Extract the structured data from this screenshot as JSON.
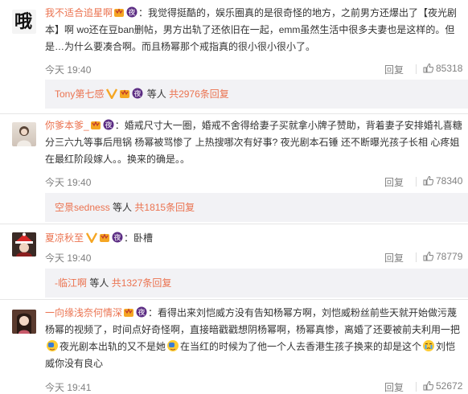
{
  "comments": [
    {
      "username": "我不适合追星啊",
      "text": "：我觉得挺酷的，娱乐圈真的是很奇怪的地方，之前男方还爆出了【夜光剧本】啊 wo还在豆ban删帖，男方出轨了还依旧在一起，emm虽然生活中很多夫妻也是这样的。但是…为什么要凑合啊。而且杨幂那个戒指真的很小很小很小了。",
      "avatar_text": "哦",
      "time": "今天 19:40",
      "reply_label": "回复",
      "likes": "85318",
      "replies": {
        "names": "Tony第七感",
        "others": "等人",
        "count": "共2976条回复"
      }
    },
    {
      "username": "你爹本爹_",
      "text": "：婚戒尺寸大一圈，婚戒不舍得给妻子买就拿小牌子赞助，背着妻子安排婚礼喜糖分三六九等事后甩锅  杨幂被骂惨了  上热搜哪次有好事? 夜光剧本石锤  还不断曝光孩子长相  心疼姐  在最红阶段嫁人。。换来的确是。。",
      "time": "今天 19:40",
      "reply_label": "回复",
      "likes": "78340",
      "replies": {
        "names": "空景sedness",
        "others": "等人",
        "count": "共1815条回复"
      }
    },
    {
      "username": "夏凉秋至",
      "text": "：卧槽",
      "time": "今天 19:40",
      "reply_label": "回复",
      "likes": "78779",
      "replies": {
        "names": "-临江啊",
        "others": "等人",
        "count": "共1327条回复"
      }
    },
    {
      "username": "一向缘浅奈何情深",
      "text_a": "：看得出来刘恺威方没有告知杨幂方啊，刘恺威粉丝前些天就开始做污蔑杨幂的视频了，时间点好奇怪啊，直接暗戳戳想阴杨幂啊，杨幂真惨，离婚了还要被前夫利用一把",
      "text_b": "夜光剧本出轨的又不是她",
      "text_c": "在当红的时候为了他一个人去香港生孩子换来的却是这个",
      "text_d": "刘恺威你没有良心",
      "time": "今天 19:41",
      "reply_label": "回复",
      "likes": "52672"
    }
  ],
  "icons": {
    "vip": "vip-crown-icon",
    "night": "night-badge-icon",
    "verified": "v-verified-icon",
    "like": "thumb-up-icon",
    "emoji_cry": "crying-face-icon",
    "emoji_facepalm": "facepalm-icon"
  },
  "colors": {
    "username": "#eb7350",
    "meta": "#808080",
    "reply_bg": "#f2f2f5"
  }
}
